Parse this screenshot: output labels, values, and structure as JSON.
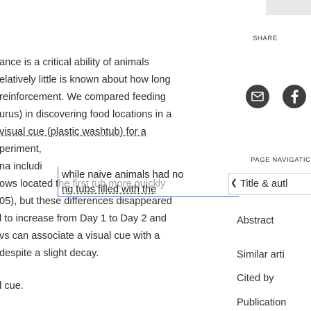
{
  "article": {
    "lines": [
      "ance is a critical ability of animals",
      "elatively little is known about how long",
      "reinforcement. We compared feeding",
      "urus) in discovering food locations in a",
      "visual cue (plastic washtub) for a",
      "periment, ",
      "na includi",
      "ows located the first tub more quickly",
      "05), but these differences disappeared",
      "l to increase from Day 1 to Day 2 and",
      "vs can associate a visual cue with a",
      "despite a slight decay.",
      "l cue."
    ]
  },
  "popup": {
    "line1": "while naive animals had no",
    "line2": "ng tubs filled with the"
  },
  "share": {
    "label": "SHARE",
    "email_icon": "email-icon",
    "facebook_icon": "facebook-icon"
  },
  "page_navigation": {
    "label": "PAGE NAVIGATIC",
    "current": "Title & autl",
    "items": [
      "Abstract",
      "Similar arti",
      "Cited by",
      "Publication"
    ]
  }
}
